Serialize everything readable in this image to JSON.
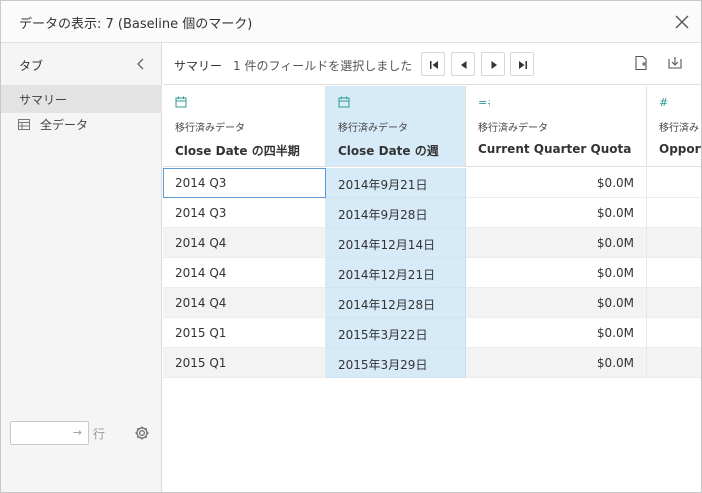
{
  "dialog": {
    "title": "データの表示: 7 (Baseline 個のマーク)"
  },
  "sidebar": {
    "header": "タブ",
    "items": [
      {
        "label": "サマリー",
        "active": true
      },
      {
        "label": "全データ",
        "active": false
      }
    ],
    "rows_label": "行",
    "rows_value": ""
  },
  "toolbar": {
    "summary_label": "サマリー",
    "selection_text": "1 件のフィールドを選択しました"
  },
  "table": {
    "columns": [
      {
        "type": "移行済みデータ",
        "name": "Close Date の四半期",
        "icon": "calendar-icon"
      },
      {
        "type": "移行済みデータ",
        "name": "Close Date の週",
        "icon": "calendar-icon",
        "selected": true
      },
      {
        "type": "移行済みデータ",
        "name": "Current Quarter Quota",
        "icon": "measure-icon"
      },
      {
        "type": "移行済み",
        "name": "Opport",
        "icon": "measure-icon"
      }
    ],
    "rows": [
      [
        "2014 Q3",
        "2014年9月21日",
        "$0.0M",
        ""
      ],
      [
        "2014 Q3",
        "2014年9月28日",
        "$0.0M",
        ""
      ],
      [
        "2014 Q4",
        "2014年12月14日",
        "$0.0M",
        ""
      ],
      [
        "2014 Q4",
        "2014年12月21日",
        "$0.0M",
        ""
      ],
      [
        "2014 Q4",
        "2014年12月28日",
        "$0.0M",
        ""
      ],
      [
        "2015 Q1",
        "2015年3月22日",
        "$0.0M",
        ""
      ],
      [
        "2015 Q1",
        "2015年3月29日",
        "$0.0M",
        ""
      ]
    ]
  },
  "colors": {
    "accent_teal": "#2a9d8f",
    "selected_column": "#d7eaf8",
    "focus_border": "#5b9bd5"
  }
}
